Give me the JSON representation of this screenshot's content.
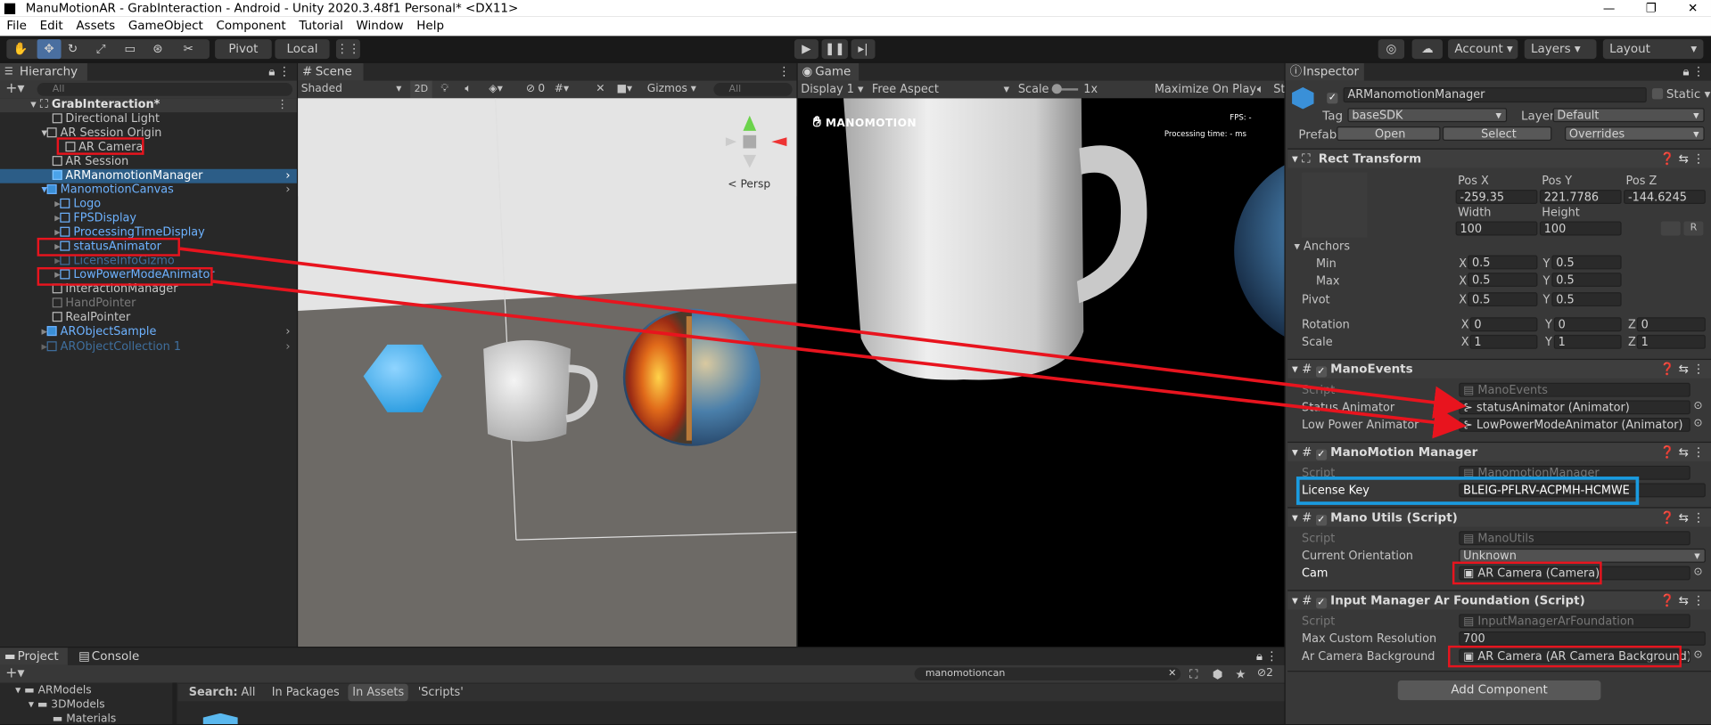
{
  "window": {
    "title": "ManuMotionAR - GrabInteraction - Android - Unity 2020.3.48f1 Personal* <DX11>"
  },
  "menu": [
    "File",
    "Edit",
    "Assets",
    "GameObject",
    "Component",
    "Tutorial",
    "Window",
    "Help"
  ],
  "toolbar": {
    "pivot": "Pivot",
    "local": "Local",
    "account": "Account",
    "layers": "Layers",
    "layout": "Layout"
  },
  "hierarchy": {
    "tab": "Hierarchy",
    "search_placeholder": "All",
    "items": [
      {
        "label": "GrabInteraction*"
      },
      {
        "label": "Directional Light"
      },
      {
        "label": "AR Session Origin"
      },
      {
        "label": "AR Camera"
      },
      {
        "label": "AR Session"
      },
      {
        "label": "ARManomotionManager"
      },
      {
        "label": "ManomotionCanvas"
      },
      {
        "label": "Logo"
      },
      {
        "label": "FPSDisplay"
      },
      {
        "label": "ProcessingTimeDisplay"
      },
      {
        "label": "statusAnimator"
      },
      {
        "label": "LicenseInfoGizmo"
      },
      {
        "label": "LowPowerModeAnimator"
      },
      {
        "label": "InteractionManager"
      },
      {
        "label": "HandPointer"
      },
      {
        "label": "RealPointer"
      },
      {
        "label": "ARObjectSample"
      },
      {
        "label": "ARObjectCollection 1"
      }
    ]
  },
  "scene": {
    "tab": "Scene",
    "shading": "Shaded",
    "mode2d": "2D",
    "gizmos": "Gizmos",
    "search_placeholder": "All",
    "persp": "< Persp",
    "hidden_count": "0"
  },
  "game": {
    "tab": "Game",
    "display": "Display 1",
    "aspect": "Free Aspect",
    "scale_label": "Scale",
    "scale_value": "1x",
    "maximize": "Maximize On Play",
    "stats": "Sta",
    "logo": "MANOMOTION",
    "fps_label": "FPS:",
    "fps_value": "-",
    "proc_label": "Processing time:",
    "proc_value": "- ms"
  },
  "project": {
    "tab1": "Project",
    "tab2": "Console",
    "search_value": "manomotioncan",
    "search_label": "Search:",
    "filters": [
      "All",
      "In Packages",
      "In Assets",
      "'Scripts'"
    ],
    "tree": [
      "ARModels",
      "3DModels",
      "Materials"
    ],
    "hidden_count": "2"
  },
  "inspector": {
    "tab": "Inspector",
    "object_name": "ARManomotionManager",
    "static": "Static",
    "tag_label": "Tag",
    "tag_value": "baseSDK",
    "layer_label": "Layer",
    "layer_value": "Default",
    "prefab_label": "Prefab",
    "open": "Open",
    "select": "Select",
    "overrides": "Overrides",
    "rect": {
      "title": "Rect Transform",
      "posx_label": "Pos X",
      "posy_label": "Pos Y",
      "posz_label": "Pos Z",
      "posx": "-259.35",
      "posy": "221.7786",
      "posz": "-144.6245",
      "width_label": "Width",
      "height_label": "Height",
      "width": "100",
      "height": "100",
      "r": "R",
      "anchors": "Anchors",
      "min": "Min",
      "max": "Max",
      "min_x": "0.5",
      "min_y": "0.5",
      "max_x": "0.5",
      "max_y": "0.5",
      "pivot": "Pivot",
      "pivot_x": "0.5",
      "pivot_y": "0.5",
      "rotation": "Rotation",
      "rot_x": "0",
      "rot_y": "0",
      "rot_z": "0",
      "scale": "Scale",
      "scale_x": "1",
      "scale_y": "1",
      "scale_z": "1",
      "x": "X",
      "y": "Y",
      "z": "Z"
    },
    "mano_events": {
      "title": "ManoEvents",
      "script_label": "Script",
      "script": "ManoEvents",
      "status_label": "Status Animator",
      "status": "statusAnimator (Animator)",
      "lowpower_label": "Low Power Animator",
      "lowpower": "LowPowerModeAnimator (Animator)"
    },
    "manager": {
      "title": "ManoMotion Manager",
      "script_label": "Script",
      "script": "ManomotionManager",
      "license_label": "License Key",
      "license": "BLEIG-PFLRV-ACPMH-HCMWE"
    },
    "utils": {
      "title": "Mano Utils (Script)",
      "script_label": "Script",
      "script": "ManoUtils",
      "orientation_label": "Current Orientation",
      "orientation": "Unknown",
      "cam_label": "Cam",
      "cam": "AR Camera (Camera)"
    },
    "input": {
      "title": "Input Manager Ar Foundation (Script)",
      "script_label": "Script",
      "script": "InputManagerArFoundation",
      "res_label": "Max Custom Resolution",
      "res": "700",
      "bg_label": "Ar Camera Background",
      "bg": "AR Camera (AR Camera Background)"
    },
    "add_component": "Add Component"
  },
  "colors": {
    "annotation_red": "#e8141e",
    "annotation_blue": "#1a9be0",
    "selection": "#2c5d87",
    "scene_sky": "#e8e8e8",
    "scene_ground": "#6d6a66"
  }
}
